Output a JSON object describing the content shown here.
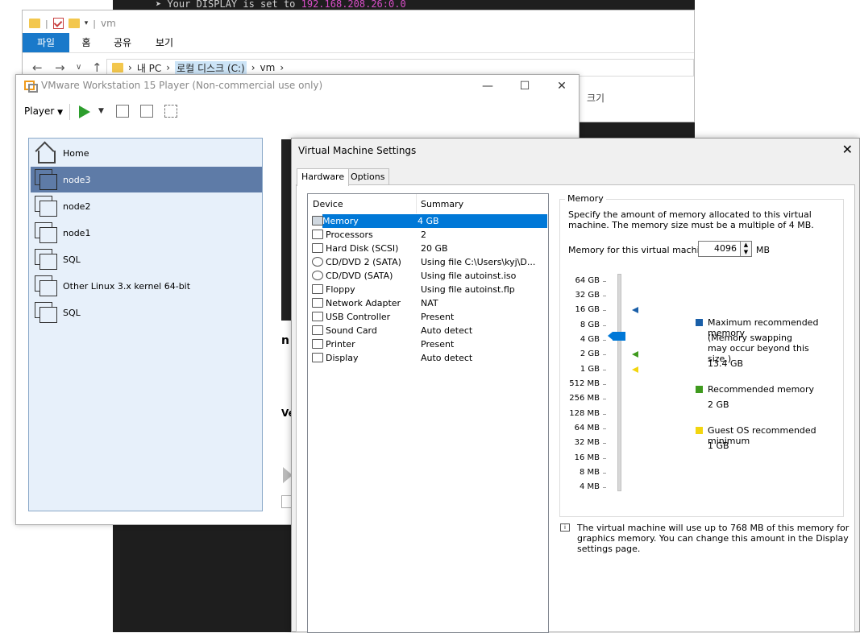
{
  "terminal": {
    "line_prefix": "➤ Your DISPLAY is set to ",
    "line_ip": "192.168.208.26:0.0"
  },
  "explorer": {
    "title": "vm",
    "ribbon_tabs": [
      "파일",
      "홈",
      "공유",
      "보기"
    ],
    "breadcrumb": [
      "내 PC",
      "로컬 디스크 (C:)",
      "vm"
    ],
    "column_size": "크기"
  },
  "player": {
    "title": "VMware Workstation 15 Player (Non-commercial use only)",
    "menu_label": "Player",
    "library": [
      "Home",
      "node3",
      "node2",
      "node1",
      "SQL",
      "Other Linux 3.x kernel 64-bit",
      "SQL"
    ],
    "selected_item": "node3",
    "partial_text": [
      "n",
      "Ve"
    ]
  },
  "settings": {
    "title": "Virtual Machine Settings",
    "tabs": [
      "Hardware",
      "Options"
    ],
    "device_header": "Device",
    "summary_header": "Summary",
    "devices": [
      {
        "name": "Memory",
        "summary": "4 GB",
        "icon": "memory-icon"
      },
      {
        "name": "Processors",
        "summary": "2",
        "icon": "processor-icon"
      },
      {
        "name": "Hard Disk (SCSI)",
        "summary": "20 GB",
        "icon": "hard-disk-icon"
      },
      {
        "name": "CD/DVD 2 (SATA)",
        "summary": "Using file C:\\Users\\kyj\\D...",
        "icon": "cd-dvd-icon"
      },
      {
        "name": "CD/DVD (SATA)",
        "summary": "Using file autoinst.iso",
        "icon": "cd-dvd-icon"
      },
      {
        "name": "Floppy",
        "summary": "Using file autoinst.flp",
        "icon": "floppy-icon"
      },
      {
        "name": "Network Adapter",
        "summary": "NAT",
        "icon": "network-icon"
      },
      {
        "name": "USB Controller",
        "summary": "Present",
        "icon": "usb-icon"
      },
      {
        "name": "Sound Card",
        "summary": "Auto detect",
        "icon": "sound-icon"
      },
      {
        "name": "Printer",
        "summary": "Present",
        "icon": "printer-icon"
      },
      {
        "name": "Display",
        "summary": "Auto detect",
        "icon": "display-icon"
      }
    ],
    "memory": {
      "group_label": "Memory",
      "description": "Specify the amount of memory allocated to this virtual machine. The memory size must be a multiple of 4 MB.",
      "input_label": "Memory for this virtual machine:",
      "value": "4096",
      "unit": "MB",
      "scale": [
        "64 GB",
        "32 GB",
        "16 GB",
        "8 GB",
        "4 GB",
        "2 GB",
        "1 GB",
        "512 MB",
        "256 MB",
        "128 MB",
        "64 MB",
        "32 MB",
        "16 MB",
        "8 MB",
        "4 MB"
      ],
      "legend": {
        "max_title": "Maximum recommended memory",
        "max_note": "(Memory swapping may occur beyond this size.)",
        "max_value": "13.4 GB",
        "rec_title": "Recommended memory",
        "rec_value": "2 GB",
        "min_title": "Guest OS recommended minimum",
        "min_value": "1 GB"
      },
      "colors": {
        "max": "#1a5fa8",
        "rec": "#3f9a1e",
        "min": "#f2d50f",
        "thumb": "#0078d7"
      },
      "info": "The virtual machine will use up to 768 MB of this memory for graphics memory. You can change this amount in the Display settings page."
    }
  }
}
